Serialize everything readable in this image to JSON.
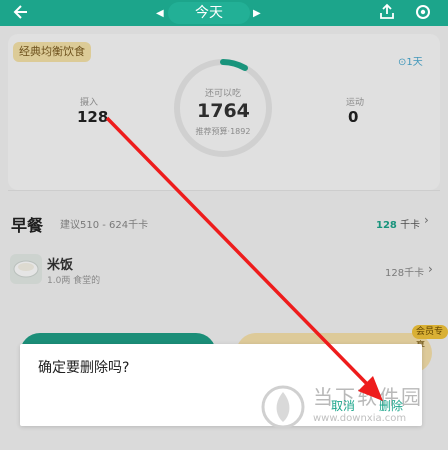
{
  "header": {
    "back_icon": "arrow-left-icon",
    "prev_icon": "triangle-left-icon",
    "date": "今天",
    "next_icon": "triangle-right-icon",
    "share_icon": "share-icon",
    "settings_icon": "gear-icon"
  },
  "summary": {
    "plan_badge": "经典均衡饮食",
    "day_tag": "⊙1天",
    "intake_label": "摄入",
    "intake_value": "128",
    "remaining_label": "还可以吃",
    "remaining_value": "1764",
    "budget_label": "推荐预算·1892",
    "exercise_label": "运动",
    "exercise_value": "0"
  },
  "meal": {
    "title": "早餐",
    "suggestion": "建议510 - 624千卡",
    "total_kcal": "128",
    "kcal_unit": "千卡",
    "chevron_icon": "chevron-right-icon"
  },
  "food": {
    "name": "米饭",
    "detail": "1.0两 食堂的",
    "kcal": "128千卡",
    "thumb_icon": "rice-bowl-icon"
  },
  "bottom": {
    "vip_tag": "会员专享"
  },
  "dialog": {
    "message": "确定要删除吗?",
    "cancel": "取消",
    "delete": "删除"
  },
  "watermark": {
    "name": "当下软件园",
    "url": "www.downxia.com"
  },
  "colors": {
    "brand": "#1ca58b",
    "arrow": "#ee1c1c",
    "badge_bg": "#f5e3a9"
  }
}
